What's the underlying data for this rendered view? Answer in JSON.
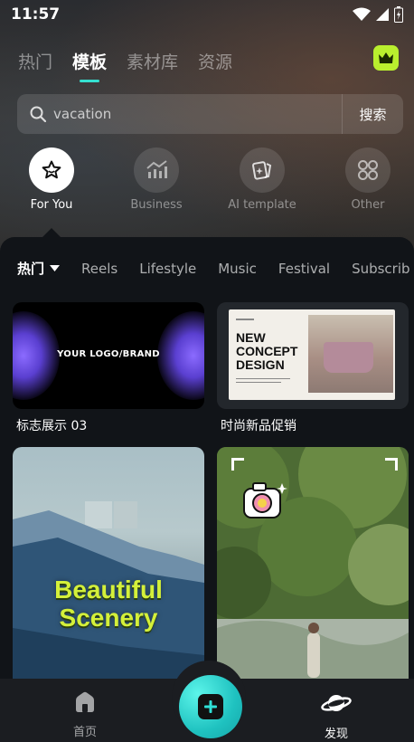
{
  "status_bar": {
    "time": "11:57"
  },
  "top_tabs": [
    {
      "label": "热门",
      "active": false
    },
    {
      "label": "模板",
      "active": true
    },
    {
      "label": "素材库",
      "active": false
    },
    {
      "label": "资源",
      "active": false
    }
  ],
  "vip_badge": {
    "icon": "crown-icon",
    "color": "#b9ef2e"
  },
  "search": {
    "value": "vacation",
    "button_label": "搜索"
  },
  "categories": [
    {
      "label": "For You",
      "icon": "star-icon",
      "active": true
    },
    {
      "label": "Business",
      "icon": "chart-icon",
      "active": false
    },
    {
      "label": "AI template",
      "icon": "ai-card-icon",
      "active": false
    },
    {
      "label": "Other",
      "icon": "grid-icon",
      "active": false
    }
  ],
  "filters": {
    "hot_label": "热门",
    "items": [
      "Reels",
      "Lifestyle",
      "Music",
      "Festival",
      "Subscrib"
    ]
  },
  "templates": [
    {
      "title": "标志展示 03",
      "overlay_text": "YOUR LOGO/BRAND"
    },
    {
      "title": "时尚新品促销",
      "overlay_text": "NEW CONCEPT DESIGN"
    },
    {
      "title": "",
      "overlay_text": "Beautiful Scenery"
    },
    {
      "title": "",
      "overlay_text": ""
    }
  ],
  "bottom_nav": [
    {
      "label": "首页",
      "icon": "home-icon",
      "active": false
    },
    {
      "label": "发现",
      "icon": "planet-icon",
      "active": true
    }
  ],
  "colors": {
    "accent": "#35e0d0",
    "fab": "#1fc2c0",
    "title_green": "#d4f03a"
  }
}
